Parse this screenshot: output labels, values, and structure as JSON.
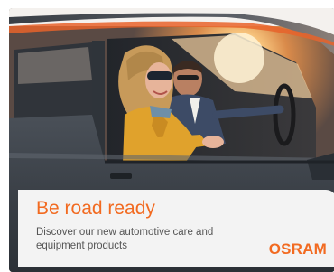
{
  "ad": {
    "headline": "Be road ready",
    "description": "Discover our new automotive care and equipment products",
    "brand": "OSRAM"
  },
  "colors": {
    "accent": "#f26a20",
    "panel_background": "#f3f3f3",
    "body_text": "#555555"
  },
  "image": {
    "subject": "woman in yellow jacket and sunglasses leaning out of car window, man driving"
  }
}
